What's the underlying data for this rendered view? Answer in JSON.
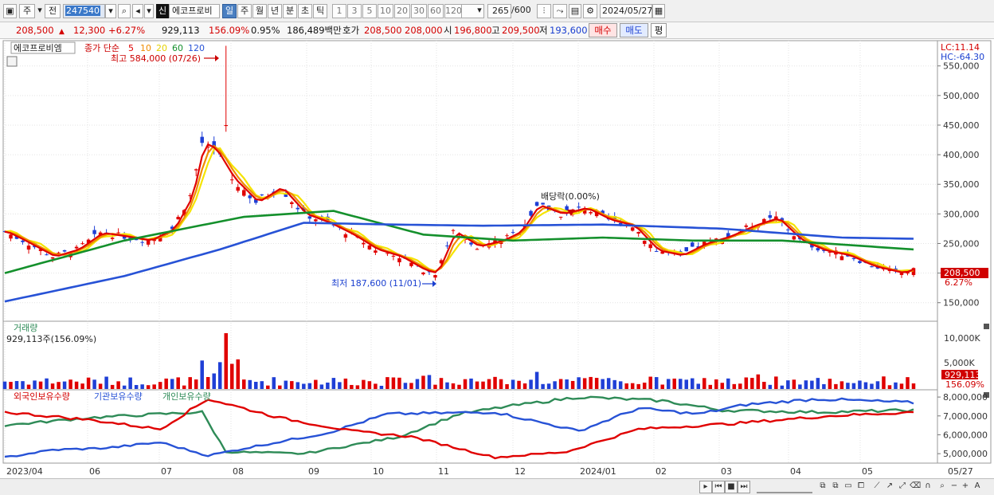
{
  "toolbar": {
    "period_label": "주",
    "prev_label": "전",
    "stock_code": "247540",
    "sin_label": "신",
    "stock_name": "에코프로비",
    "interval_buttons": [
      "일",
      "주",
      "월",
      "년",
      "분",
      "초",
      "틱"
    ],
    "selected_interval": "일",
    "tick_numbers": [
      "1",
      "3",
      "5",
      "10",
      "20",
      "30",
      "60",
      "120"
    ],
    "count_display": "265",
    "count_max": "/600",
    "date_value": "2024/05/27"
  },
  "quote": {
    "price": "208,500",
    "change": "12,300",
    "change_pct": "+6.27%",
    "volume": "929,113",
    "volume_ratio": "156.09%",
    "turnover": "0.95%",
    "amount": "186,489백만",
    "ask_label": "호가",
    "ask1": "208,500",
    "ask2": "208,000",
    "open_label": "시",
    "open": "196,800",
    "high_label": "고",
    "high": "209,500",
    "low_label": "저",
    "low": "193,600",
    "buy_label": "매수",
    "sell_label": "매도",
    "eval_label": "평"
  },
  "chart": {
    "legend_name": "에코프로비엠",
    "legend_ma_label": "종가 단순",
    "ma_periods": [
      "5",
      "10",
      "20",
      "60",
      "120"
    ],
    "lc_label": "LC:11.14",
    "hc_label": "HC:-64.30",
    "max_annotation": "최고 584,000 (07/26)",
    "min_annotation": "최저 187,600 (11/01)",
    "dividend_annotation": "배당락(0.00%)",
    "current_price_label": "208,500",
    "current_pct_label": "6.27%",
    "price_axis": [
      "550,000",
      "500,000",
      "450,000",
      "400,000",
      "350,000",
      "300,000",
      "250,000",
      "200,000",
      "150,000"
    ],
    "volume_title": "거래량",
    "volume_value": "929,113주(156.09%)",
    "volume_axis": [
      "10,000K",
      "5,000K"
    ],
    "volume_current": "929,113",
    "volume_pct": "156.09%",
    "holdings_legend": [
      "외국인보유수량",
      "기관보유수량",
      "개인보유수량"
    ],
    "holdings_axis": [
      "8,000,000",
      "7,000,000",
      "6,000,000",
      "5,000,000"
    ],
    "date_labels": [
      "2023/04",
      "06",
      "07",
      "08",
      "09",
      "10",
      "11",
      "12",
      "2024/01",
      "02",
      "03",
      "04",
      "05",
      "05/27"
    ]
  },
  "colors": {
    "ma5": "#e00000",
    "ma10": "#f08c00",
    "ma20": "#f5e400",
    "ma60": "#14902c",
    "ma120": "#2752d6",
    "up": "#e00000",
    "down": "#1f3fd6",
    "foreign": "#2752d6",
    "institution": "#e00000",
    "individual": "#2e8b57"
  },
  "chart_data": {
    "type": "candlestick",
    "price_range": [
      120000,
      590000
    ],
    "high_point": {
      "date": "2023/07/26",
      "value": 584000
    },
    "low_point": {
      "date": "2023/11/01",
      "value": 187600
    },
    "close_path": [
      [
        0,
        270000
      ],
      [
        3,
        255000
      ],
      [
        8,
        228000
      ],
      [
        12,
        240000
      ],
      [
        16,
        268000
      ],
      [
        20,
        262000
      ],
      [
        24,
        255000
      ],
      [
        28,
        275000
      ],
      [
        31,
        330000
      ],
      [
        33,
        420000
      ],
      [
        35,
        410000
      ],
      [
        38,
        360000
      ],
      [
        42,
        320000
      ],
      [
        46,
        345000
      ],
      [
        50,
        300000
      ],
      [
        54,
        285000
      ],
      [
        58,
        265000
      ],
      [
        62,
        240000
      ],
      [
        66,
        228000
      ],
      [
        70,
        205000
      ],
      [
        72,
        200000
      ],
      [
        75,
        270000
      ],
      [
        79,
        245000
      ],
      [
        83,
        255000
      ],
      [
        86,
        270000
      ],
      [
        89,
        315000
      ],
      [
        93,
        300000
      ],
      [
        97,
        310000
      ],
      [
        101,
        290000
      ],
      [
        105,
        280000
      ],
      [
        109,
        238000
      ],
      [
        113,
        230000
      ],
      [
        117,
        250000
      ],
      [
        121,
        262000
      ],
      [
        125,
        280000
      ],
      [
        129,
        293000
      ],
      [
        133,
        255000
      ],
      [
        137,
        238000
      ],
      [
        141,
        230000
      ],
      [
        145,
        212000
      ],
      [
        150,
        200000
      ],
      [
        152,
        208500
      ]
    ],
    "ma_price_path": {
      "ma60": [
        [
          0,
          200000
        ],
        [
          20,
          255000
        ],
        [
          40,
          295000
        ],
        [
          55,
          305000
        ],
        [
          70,
          265000
        ],
        [
          85,
          255000
        ],
        [
          100,
          260000
        ],
        [
          115,
          255000
        ],
        [
          130,
          255000
        ],
        [
          152,
          240000
        ]
      ],
      "ma120": [
        [
          0,
          152000
        ],
        [
          20,
          195000
        ],
        [
          36,
          240000
        ],
        [
          50,
          285000
        ],
        [
          65,
          282000
        ],
        [
          80,
          280000
        ],
        [
          100,
          282000
        ],
        [
          120,
          275000
        ],
        [
          140,
          260000
        ],
        [
          152,
          258000
        ]
      ]
    },
    "holdings_range": [
      4500000,
      8300000
    ],
    "foreign_path": [
      [
        0,
        4800000
      ],
      [
        8,
        5200000
      ],
      [
        17,
        5300000
      ],
      [
        26,
        5600000
      ],
      [
        34,
        4900000
      ],
      [
        42,
        5400000
      ],
      [
        54,
        6100000
      ],
      [
        64,
        7100000
      ],
      [
        82,
        7200000
      ],
      [
        96,
        6200000
      ],
      [
        106,
        7400000
      ],
      [
        116,
        7100000
      ],
      [
        124,
        7600000
      ],
      [
        136,
        7900000
      ],
      [
        152,
        7700000
      ]
    ],
    "institution_path": [
      [
        0,
        7200000
      ],
      [
        14,
        6800000
      ],
      [
        26,
        6300000
      ],
      [
        34,
        7900000
      ],
      [
        46,
        6900000
      ],
      [
        58,
        6200000
      ],
      [
        68,
        5900000
      ],
      [
        82,
        4800000
      ],
      [
        94,
        5100000
      ],
      [
        106,
        6300000
      ],
      [
        122,
        6600000
      ],
      [
        138,
        7000000
      ],
      [
        152,
        7200000
      ]
    ],
    "individual_path": [
      [
        0,
        6500000
      ],
      [
        14,
        6900000
      ],
      [
        26,
        7100000
      ],
      [
        33,
        7200000
      ],
      [
        37,
        5100000
      ],
      [
        50,
        5000000
      ],
      [
        66,
        5900000
      ],
      [
        76,
        7100000
      ],
      [
        84,
        7500000
      ],
      [
        96,
        8000000
      ],
      [
        110,
        7800000
      ],
      [
        120,
        7300000
      ],
      [
        136,
        7200000
      ],
      [
        152,
        7300000
      ]
    ]
  }
}
